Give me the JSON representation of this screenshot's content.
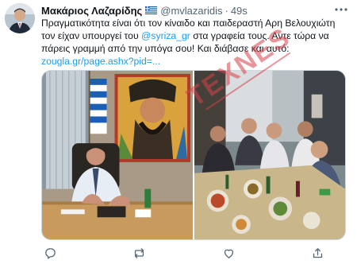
{
  "tweet": {
    "display_name": "Μακάριος Λαζαρίδης",
    "flag_icon": "greek-flag-icon",
    "handle": "@mvlazaridis",
    "separator": "·",
    "time": "49s",
    "more_icon": "more-horizontal-icon",
    "text": {
      "line1": "Πραγματικότητα είναι ότι τον κίναιδο και παιδεραστή Αρη Βελουχιώτη",
      "line2_before": "τον είχαν υπουργεί του ",
      "line2_mention": "@syriza_gr",
      "line2_after": " στα γραφεία τους. Αντε τώρα να",
      "line3": "πάρεις γραμμή από την υπόγα σου! Και διάβασε και αυτό:",
      "link": "zougla.gr/page.ashx?pid=..."
    },
    "watermark": "TEXNES",
    "media": {
      "left_photo": "office-photo",
      "right_photo": "dinner-photo"
    },
    "actions": [
      {
        "icon": "reply-icon"
      },
      {
        "icon": "retweet-icon"
      },
      {
        "icon": "like-icon"
      },
      {
        "icon": "share-icon"
      }
    ]
  },
  "colors": {
    "link": "#1d9bf0",
    "text": "#0f1419",
    "secondary": "#536471",
    "watermark": "#d6424a"
  }
}
